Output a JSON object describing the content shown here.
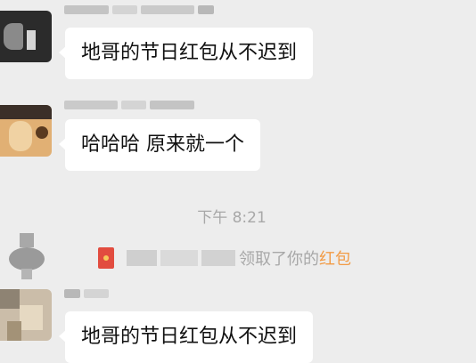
{
  "messages": [
    {
      "text": "地哥的节日红包从不迟到"
    },
    {
      "text": "哈哈哈 原来就一个"
    },
    {
      "text": "地哥的节日红包从不迟到"
    }
  ],
  "timestamp": "下午 8:21",
  "system_message": {
    "text": "领取了你的",
    "link": "红包",
    "link_color": "#f29b45"
  },
  "colors": {
    "background": "#ededed",
    "bubble": "#ffffff",
    "timestamp": "#a8a8a8"
  },
  "icons": {
    "red_packet": "red-envelope-icon"
  }
}
